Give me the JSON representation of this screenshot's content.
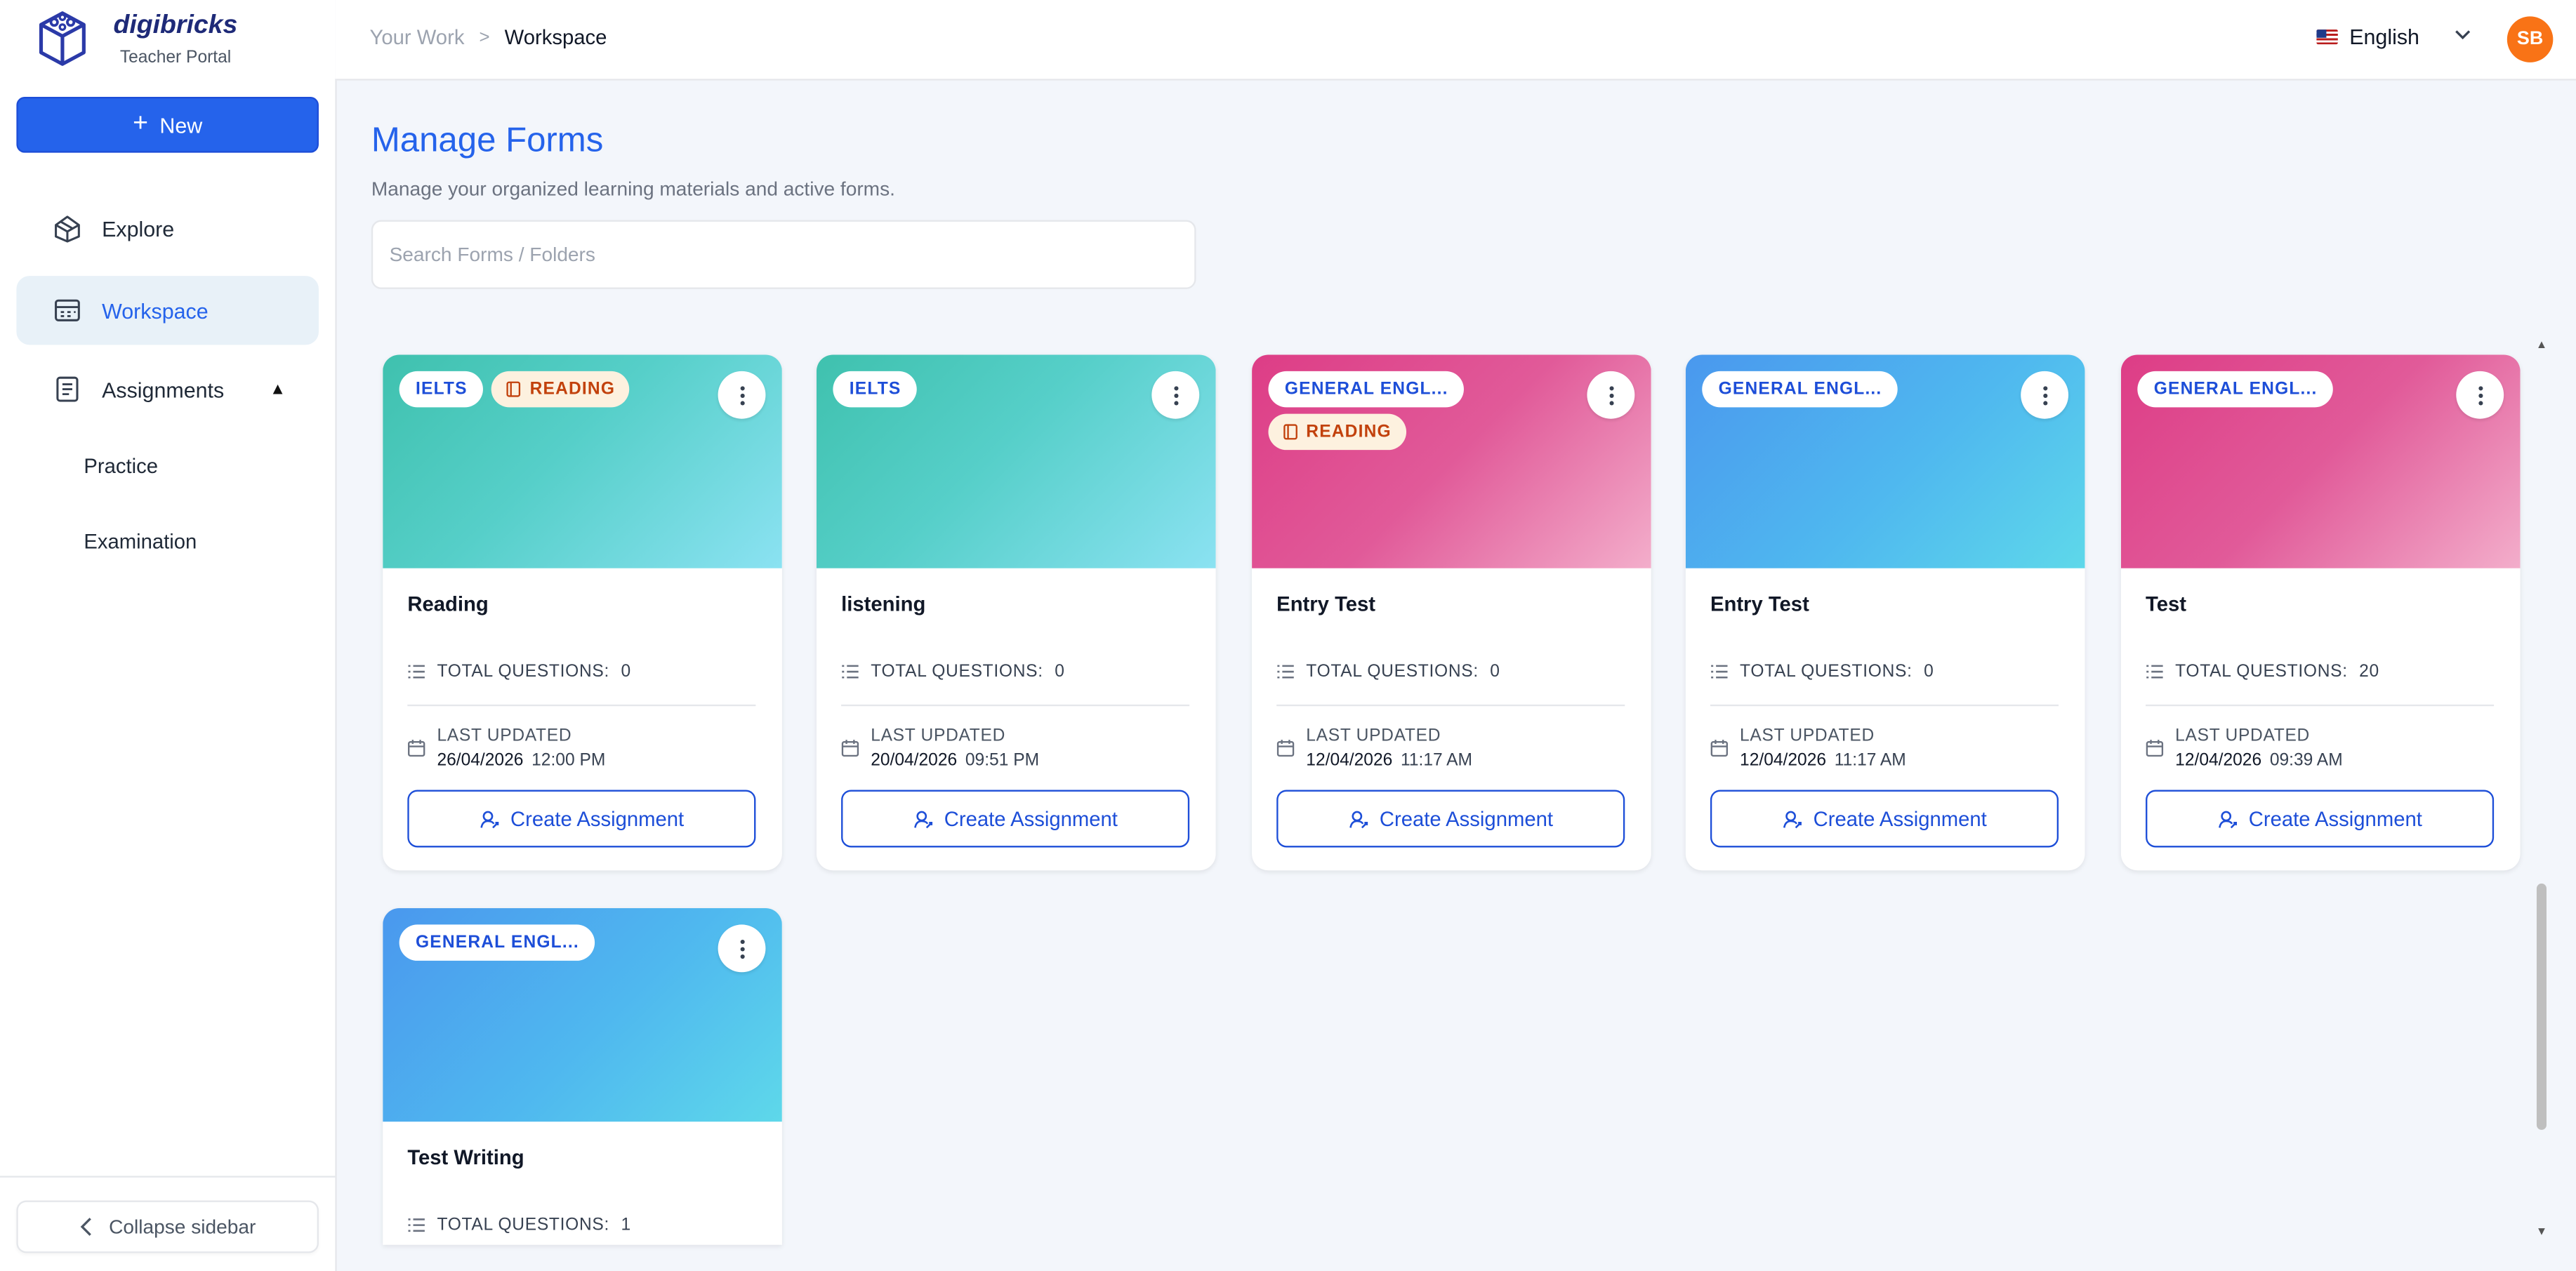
{
  "brand": {
    "name": "digibricks",
    "subtitle": "Teacher Portal"
  },
  "sidebar": {
    "new_label": "New",
    "items": [
      {
        "label": "Explore"
      },
      {
        "label": "Workspace"
      },
      {
        "label": "Assignments"
      }
    ],
    "sub_items": [
      "Practice",
      "Examination"
    ],
    "collapse_label": "Collapse sidebar"
  },
  "header": {
    "breadcrumb": [
      "Your Work",
      "Workspace"
    ],
    "breadcrumb_sep": ">",
    "language": "English",
    "avatar_initials": "SB"
  },
  "main": {
    "title": "Manage Forms",
    "subtitle": "Manage your organized learning materials and active forms.",
    "search_placeholder": "Search Forms / Folders"
  },
  "colors": {
    "accent": "#2563eb",
    "avatar": "#f97316",
    "reading_badge": "#c2410c"
  },
  "labels": {
    "total_questions": "TOTAL QUESTIONS:",
    "last_updated": "LAST UPDATED",
    "create_assignment": "Create Assignment"
  },
  "cards": [
    {
      "title": "Reading",
      "tags": [
        "IELTS",
        "READING"
      ],
      "questions": "0",
      "date": "26/04/2026",
      "time": "12:00 PM"
    },
    {
      "title": "listening",
      "tags": [
        "IELTS"
      ],
      "questions": "0",
      "date": "20/04/2026",
      "time": "09:51 PM"
    },
    {
      "title": "Entry Test",
      "tags": [
        "GENERAL ENGL...",
        "READING"
      ],
      "questions": "0",
      "date": "12/04/2026",
      "time": "11:17 AM"
    },
    {
      "title": "Entry Test",
      "tags": [
        "GENERAL ENGL..."
      ],
      "questions": "0",
      "date": "12/04/2026",
      "time": "11:17 AM"
    },
    {
      "title": "Test",
      "tags": [
        "GENERAL ENGL..."
      ],
      "questions": "20",
      "date": "12/04/2026",
      "time": "09:39 AM"
    },
    {
      "title": "Test Writing",
      "tags": [
        "GENERAL ENGL..."
      ],
      "questions": "1"
    }
  ]
}
